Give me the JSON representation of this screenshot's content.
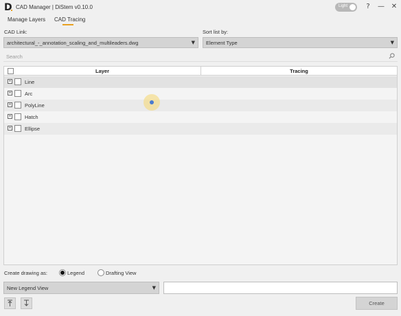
{
  "app": {
    "logo": "D",
    "title": "CAD Manager | DiStem v0.10.0",
    "theme_toggle_label": "Light"
  },
  "window_controls": {
    "help": "?",
    "minimize": "—",
    "close": "✕"
  },
  "tabs": [
    {
      "label": "Manage Layers",
      "active": false
    },
    {
      "label": "CAD Tracing",
      "active": true
    }
  ],
  "cad_link": {
    "label": "CAD Link:",
    "value": "architectural_-_annotation_scaling_and_multileaders.dwg"
  },
  "sort": {
    "label": "Sort list by:",
    "value": "Element Type"
  },
  "search": {
    "placeholder": "Search"
  },
  "tree": {
    "columns": [
      "Layer",
      "Tracing"
    ],
    "rows": [
      {
        "name": "Line",
        "tracing": ""
      },
      {
        "name": "Arc",
        "tracing": ""
      },
      {
        "name": "PolyLine",
        "tracing": ""
      },
      {
        "name": "Hatch",
        "tracing": ""
      },
      {
        "name": "Ellipse",
        "tracing": ""
      }
    ]
  },
  "create_drawing": {
    "label": "Create drawing as:",
    "options": [
      {
        "label": "Legend",
        "selected": true
      },
      {
        "label": "Drafting View",
        "selected": false
      }
    ]
  },
  "view_select": {
    "value": "New Legend View"
  },
  "view_name_input": {
    "value": ""
  },
  "create_button": {
    "label": "Create"
  },
  "colors": {
    "accent": "#e8a020",
    "background": "#f0f0f0"
  }
}
